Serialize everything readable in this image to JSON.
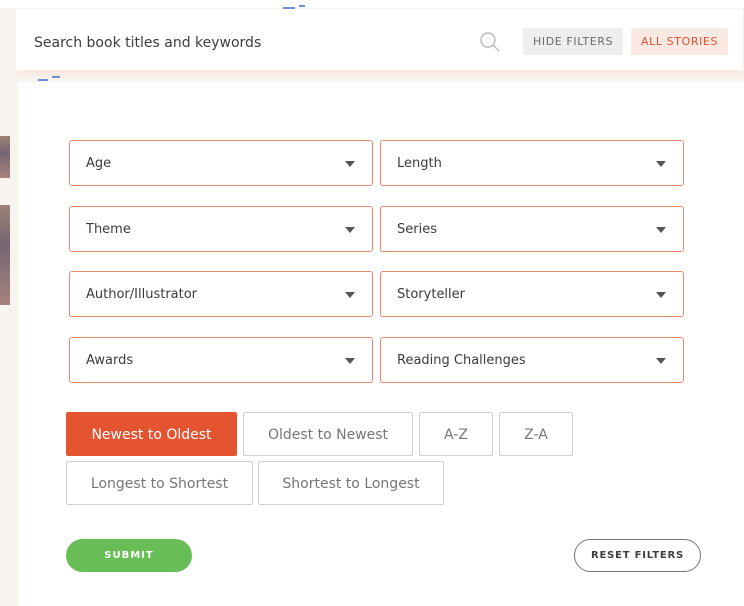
{
  "search": {
    "placeholder": "Search book titles and keywords",
    "hide_filters_label": "HIDE FILTERS",
    "all_stories_label": "ALL STORIES"
  },
  "filters": [
    {
      "label": "Age"
    },
    {
      "label": "Length"
    },
    {
      "label": "Theme"
    },
    {
      "label": "Series"
    },
    {
      "label": "Author/Illustrator"
    },
    {
      "label": "Storyteller"
    },
    {
      "label": "Awards"
    },
    {
      "label": "Reading Challenges"
    }
  ],
  "sort_options": [
    {
      "label": "Newest to Oldest",
      "active": true
    },
    {
      "label": "Oldest to Newest",
      "active": false
    },
    {
      "label": "A-Z",
      "active": false
    },
    {
      "label": "Z-A",
      "active": false
    },
    {
      "label": "Longest to Shortest",
      "active": false
    },
    {
      "label": "Shortest to Longest",
      "active": false
    }
  ],
  "actions": {
    "submit_label": "SUBMIT",
    "reset_label": "RESET FILTERS"
  },
  "colors": {
    "accent": "#e55431",
    "submit": "#69bd57",
    "select_border": "#e68a6e"
  },
  "icons": {
    "search": "search-icon",
    "dropdown": "chevron-down-icon"
  }
}
